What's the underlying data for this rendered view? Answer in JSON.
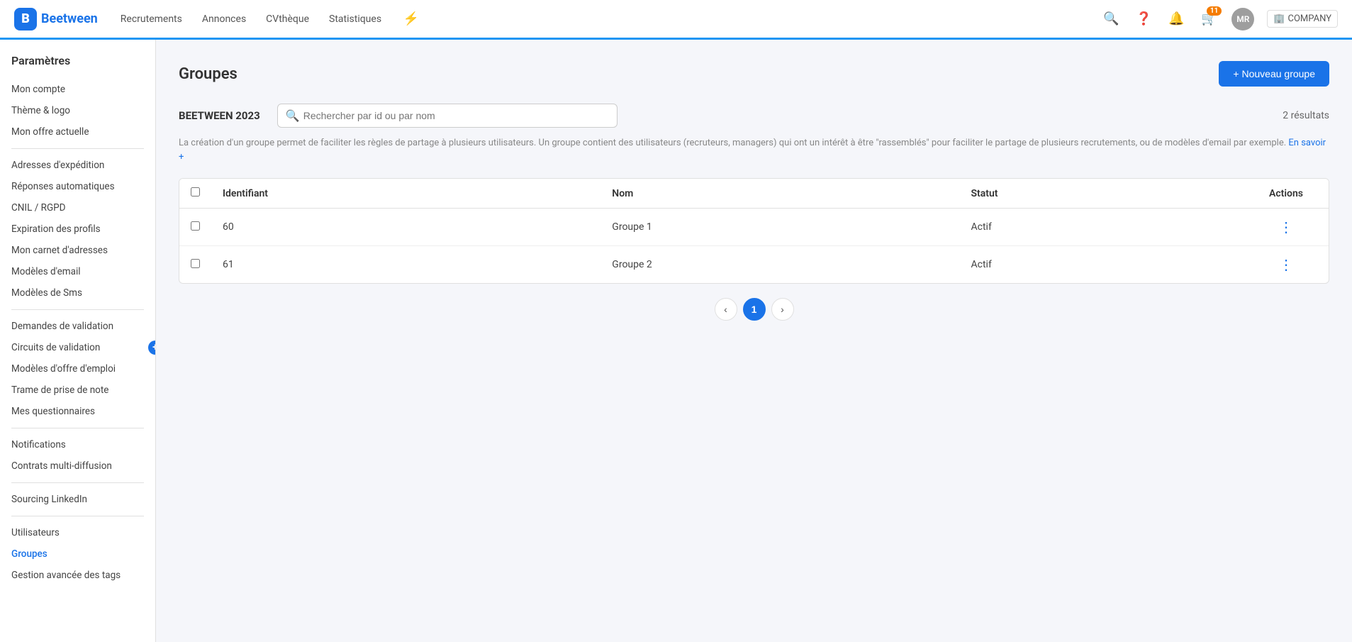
{
  "topnav": {
    "logo_letter": "B",
    "logo_text": "Beetween",
    "nav_links": [
      {
        "label": "Recrutements",
        "id": "recrutements"
      },
      {
        "label": "Annonces",
        "id": "annonces"
      },
      {
        "label": "CVthèque",
        "id": "cvtheque"
      },
      {
        "label": "Statistiques",
        "id": "statistiques"
      }
    ],
    "notification_badge": "11",
    "avatar_initials": "MR",
    "company_label": "COMPANY"
  },
  "sidebar": {
    "title": "Paramètres",
    "items": [
      {
        "label": "Mon compte",
        "id": "mon-compte",
        "group": 1
      },
      {
        "label": "Thème & logo",
        "id": "theme-logo",
        "group": 1
      },
      {
        "label": "Mon offre actuelle",
        "id": "mon-offre",
        "group": 1
      },
      {
        "label": "Adresses d'expédition",
        "id": "adresses",
        "group": 2
      },
      {
        "label": "Réponses automatiques",
        "id": "reponses",
        "group": 2
      },
      {
        "label": "CNIL / RGPD",
        "id": "cnil",
        "group": 2
      },
      {
        "label": "Expiration des profils",
        "id": "expiration",
        "group": 2
      },
      {
        "label": "Mon carnet d'adresses",
        "id": "carnet",
        "group": 2
      },
      {
        "label": "Modèles d'email",
        "id": "modeles-email",
        "group": 2
      },
      {
        "label": "Modèles de Sms",
        "id": "modeles-sms",
        "group": 2
      },
      {
        "label": "Demandes de validation",
        "id": "demandes",
        "group": 3
      },
      {
        "label": "Circuits de validation",
        "id": "circuits",
        "group": 3,
        "has_plus": true
      },
      {
        "label": "Modèles d'offre d'emploi",
        "id": "modeles-offre",
        "group": 3
      },
      {
        "label": "Trame de prise de note",
        "id": "trame",
        "group": 3
      },
      {
        "label": "Mes questionnaires",
        "id": "questionnaires",
        "group": 3
      },
      {
        "label": "Notifications",
        "id": "notifications",
        "group": 4
      },
      {
        "label": "Contrats multi-diffusion",
        "id": "contrats",
        "group": 4
      },
      {
        "label": "Sourcing LinkedIn",
        "id": "linkedin",
        "group": 5
      },
      {
        "label": "Utilisateurs",
        "id": "utilisateurs",
        "group": 6
      },
      {
        "label": "Groupes",
        "id": "groupes",
        "group": 6,
        "active": true
      },
      {
        "label": "Gestion avancée des tags",
        "id": "tags",
        "group": 6
      }
    ]
  },
  "page": {
    "title": "Groupes",
    "new_group_btn": "+ Nouveau groupe",
    "section_name": "BEETWEEN 2023",
    "search_placeholder": "Rechercher par id ou par nom",
    "results_count": "2 résultats",
    "description": "La création d'un groupe permet de faciliter les règles de partage à plusieurs utilisateurs. Un groupe contient des utilisateurs (recruteurs, managers) qui ont un intérêt à être \"rassemblés\" pour faciliter le partage de plusieurs recrutements, ou de modèles d'email par exemple.",
    "learn_more": "En savoir +",
    "table": {
      "columns": [
        "Identifiant",
        "Nom",
        "Statut",
        "Actions"
      ],
      "rows": [
        {
          "id": "60",
          "nom": "Groupe 1",
          "statut": "Actif"
        },
        {
          "id": "61",
          "nom": "Groupe 2",
          "statut": "Actif"
        }
      ]
    },
    "pagination": {
      "prev": "‹",
      "current": "1",
      "next": "›"
    }
  }
}
